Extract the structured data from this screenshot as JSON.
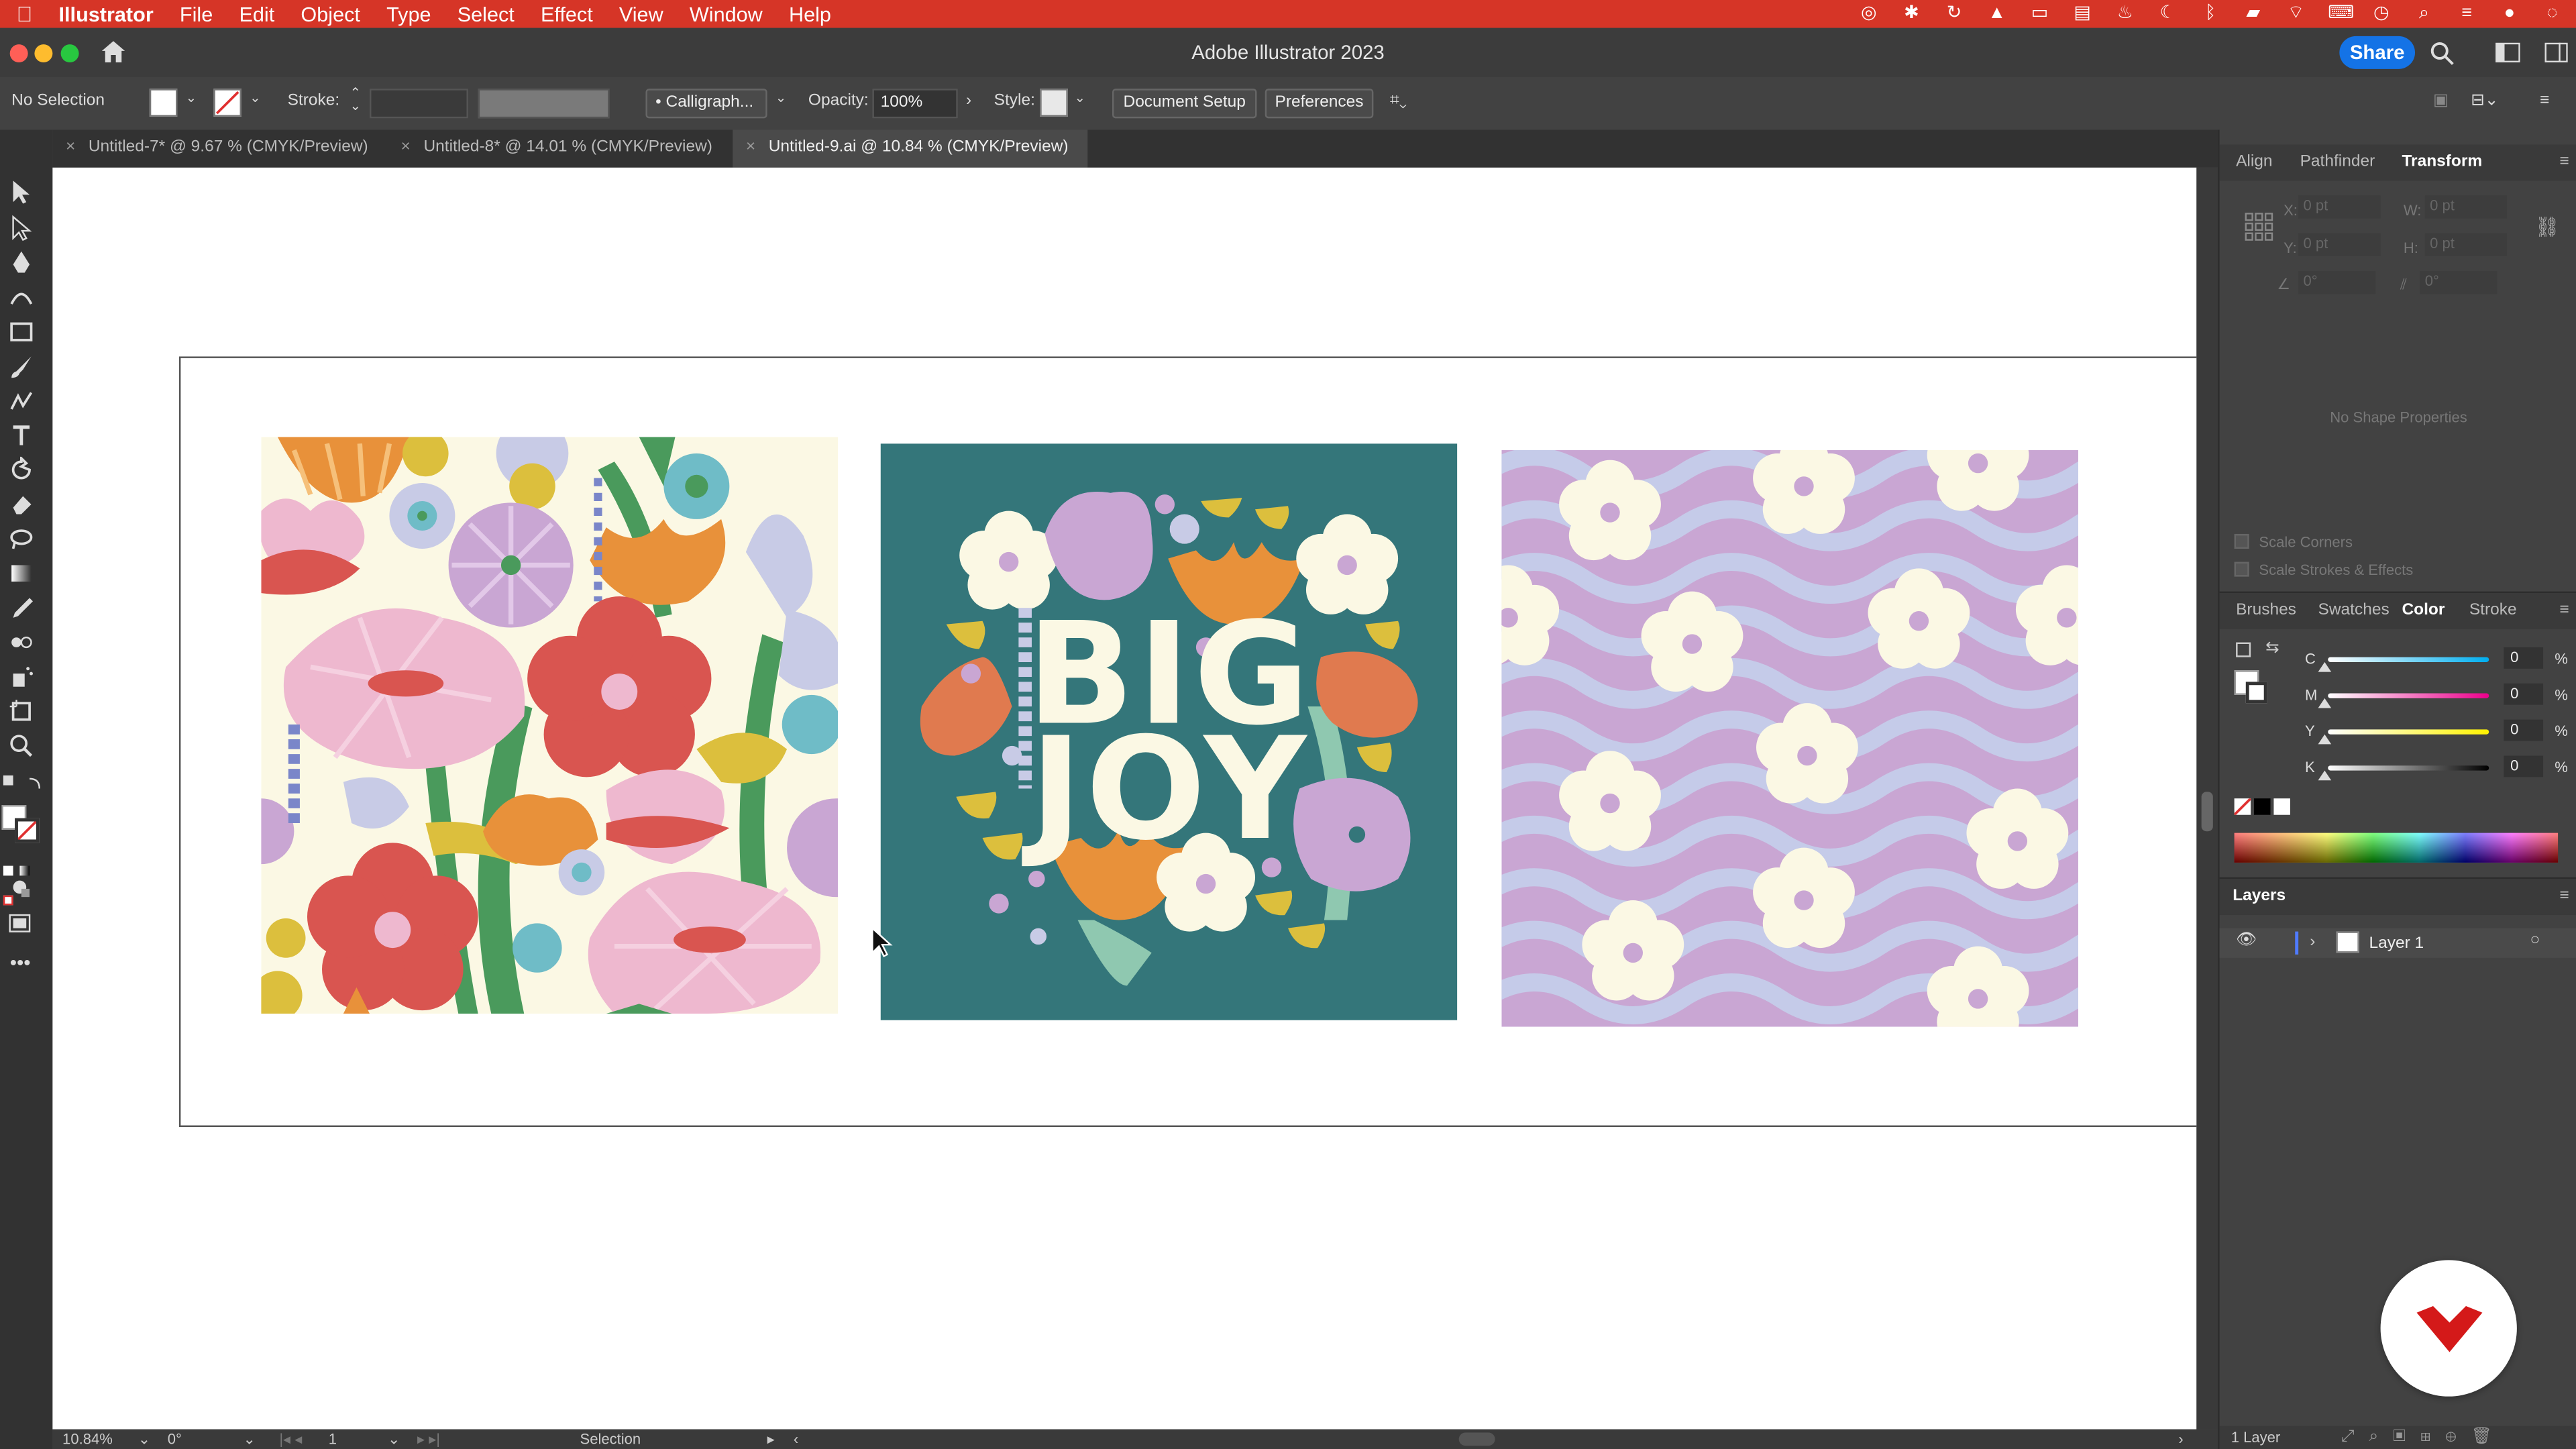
{
  "menubar": {
    "apple": "",
    "app_name": "Illustrator",
    "items": [
      "File",
      "Edit",
      "Object",
      "Type",
      "Select",
      "Effect",
      "View",
      "Window",
      "Help"
    ]
  },
  "titlebar": {
    "title": "Adobe Illustrator 2023",
    "share_label": "Share"
  },
  "control_bar": {
    "selection_label": "No Selection",
    "stroke_label": "Stroke:",
    "brush_label": "Calligraph...",
    "opacity_label": "Opacity:",
    "opacity_value": "100%",
    "style_label": "Style:",
    "document_setup_label": "Document Setup",
    "preferences_label": "Preferences"
  },
  "tabs": [
    {
      "label": "Untitled-7* @ 9.67 % (CMYK/Preview)",
      "close": "×"
    },
    {
      "label": "Untitled-8* @ 14.01 % (CMYK/Preview)",
      "close": "×"
    },
    {
      "label": "Untitled-9.ai @ 10.84 % (CMYK/Preview)",
      "close": "×"
    }
  ],
  "artwork": {
    "middle_text_line1": "BIG",
    "middle_text_line2": "JOY"
  },
  "statusbar": {
    "zoom": "10.84%",
    "rotation": "0°",
    "artboard_number": "1",
    "tool_name": "Selection"
  },
  "transform_panel": {
    "tabs": [
      "Align",
      "Pathfinder",
      "Transform"
    ],
    "x_label": "X:",
    "x_value": "0 pt",
    "y_label": "Y:",
    "y_value": "0 pt",
    "w_label": "W:",
    "w_value": "0 pt",
    "h_label": "H:",
    "h_value": "0 pt",
    "angle_value": "0°",
    "shear_value": "0°",
    "no_shape": "No Shape Properties",
    "scale_corners": "Scale Corners",
    "scale_strokes": "Scale Strokes & Effects"
  },
  "color_panel": {
    "tabs": [
      "Brushes",
      "Swatches",
      "Color",
      "Stroke"
    ],
    "channels": [
      {
        "label": "C",
        "value": "0",
        "unit": "%"
      },
      {
        "label": "M",
        "value": "0",
        "unit": "%"
      },
      {
        "label": "Y",
        "value": "0",
        "unit": "%"
      },
      {
        "label": "K",
        "value": "0",
        "unit": "%"
      }
    ]
  },
  "layers_panel": {
    "title": "Layers",
    "layer_name": "Layer 1",
    "layer_count": "1 Layer"
  },
  "colors": {
    "menubar": "#d63527",
    "teal": "#34767a",
    "pink": "#eeb8cf",
    "red": "#d95550",
    "orange": "#e8913a",
    "lavender": "#c9a6d3",
    "cream": "#fbf8e4"
  }
}
